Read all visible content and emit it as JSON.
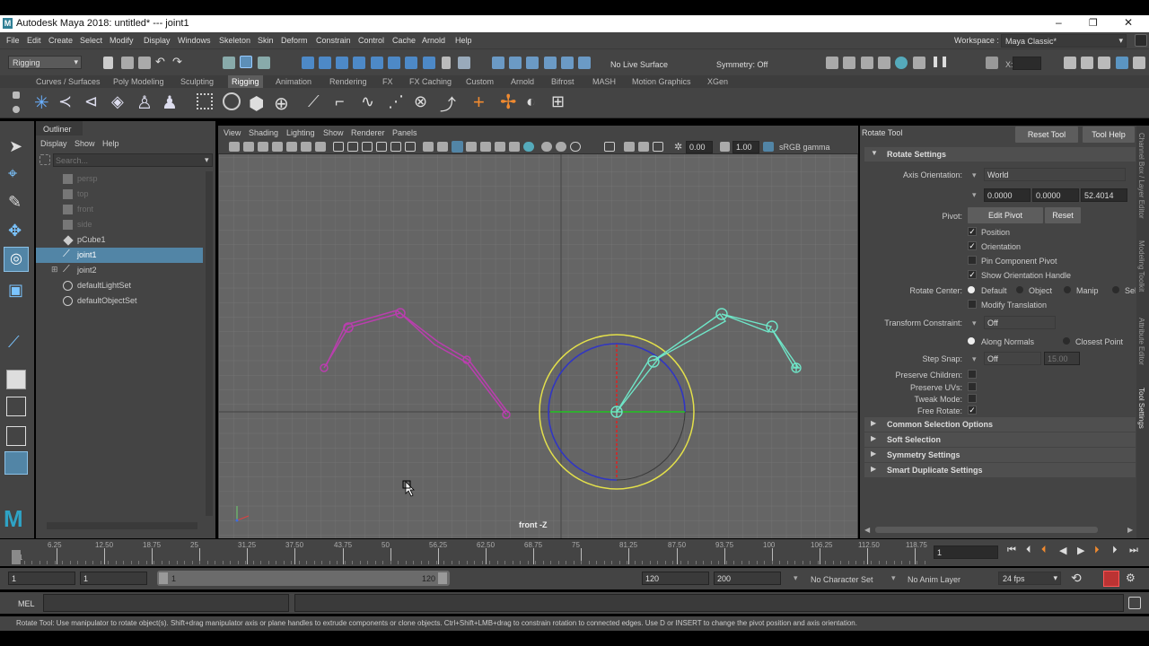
{
  "window": {
    "title": "Autodesk Maya 2018: untitled*   ---   joint1",
    "controls": [
      "–",
      "❐",
      "✕"
    ]
  },
  "menubar": {
    "items": [
      "File",
      "Edit",
      "Create",
      "Select",
      "Modify",
      "Display",
      "Windows",
      "Skeleton",
      "Skin",
      "Deform",
      "Constrain",
      "Control",
      "Cache",
      "Arnold",
      "Help"
    ],
    "workspace_label": "Workspace :",
    "workspace_value": "Maya Classic*"
  },
  "statusline": {
    "menuset": "Rigging",
    "live_surface": "No Live Surface",
    "symmetry": "Symmetry: Off",
    "x_label": "X:"
  },
  "shelf_tabs": {
    "items": [
      "Curves / Surfaces",
      "Poly Modeling",
      "Sculpting",
      "Rigging",
      "Animation",
      "Rendering",
      "FX",
      "FX Caching",
      "Custom",
      "Arnold",
      "Bifrost",
      "MASH",
      "Motion Graphics",
      "XGen"
    ],
    "active": "Rigging"
  },
  "outliner": {
    "title": "Outliner",
    "menu": [
      "Display",
      "Show",
      "Help"
    ],
    "search_placeholder": "Search...",
    "items": [
      {
        "name": "persp",
        "dim": true,
        "icon": "camera-icon"
      },
      {
        "name": "top",
        "dim": true,
        "icon": "camera-icon"
      },
      {
        "name": "front",
        "dim": true,
        "icon": "camera-icon"
      },
      {
        "name": "side",
        "dim": true,
        "icon": "camera-icon"
      },
      {
        "name": "pCube1",
        "dim": false,
        "icon": "mesh-icon"
      },
      {
        "name": "joint1",
        "dim": false,
        "icon": "joint-icon",
        "selected": true
      },
      {
        "name": "joint2",
        "dim": false,
        "icon": "joint-icon",
        "expand": true
      },
      {
        "name": "defaultLightSet",
        "dim": false,
        "icon": "set-icon"
      },
      {
        "name": "defaultObjectSet",
        "dim": false,
        "icon": "set-icon"
      }
    ]
  },
  "viewport": {
    "menu": [
      "View",
      "Shading",
      "Lighting",
      "Show",
      "Renderer",
      "Panels"
    ],
    "exposure": "0.00",
    "gamma": "1.00",
    "colorspace": "sRGB gamma",
    "camera_label": "front -Z"
  },
  "attr": {
    "panel_title": "Rotate Tool",
    "reset_tool": "Reset Tool",
    "tool_help": "Tool Help",
    "section_rotate": "Rotate Settings",
    "axis_orientation_label": "Axis Orientation:",
    "axis_orientation_value": "World",
    "axis_values": [
      "0.0000",
      "0.0000",
      "52.4014"
    ],
    "pivot_label": "Pivot:",
    "edit_pivot": "Edit Pivot",
    "reset": "Reset",
    "position": "Position",
    "orientation": "Orientation",
    "pin_component_pivot": "Pin Component Pivot",
    "show_orientation_handle": "Show Orientation Handle",
    "rotate_center_label": "Rotate Center:",
    "rotate_center_options": [
      "Default",
      "Object",
      "Manip",
      "Sel"
    ],
    "modify_translation": "Modify Translation",
    "transform_constraint_label": "Transform Constraint:",
    "transform_constraint_value": "Off",
    "along_normals": "Along Normals",
    "closest_point": "Closest Point",
    "step_snap_label": "Step Snap:",
    "step_snap_value": "Off",
    "step_snap_amount": "15.00",
    "preserve_children": "Preserve Children:",
    "preserve_uvs": "Preserve UVs:",
    "tweak_mode": "Tweak Mode:",
    "free_rotate": "Free Rotate:",
    "sections": [
      "Common Selection Options",
      "Soft Selection",
      "Symmetry Settings",
      "Smart Duplicate Settings"
    ]
  },
  "side_tabs": [
    "Channel Box / Layer Editor",
    "Modeling Toolkit",
    "Attribute Editor",
    "Tool Settings"
  ],
  "timeline": {
    "ticks": [
      "1",
      "6.25",
      "12.50",
      "18.75",
      "25",
      "31.25",
      "37.50",
      "43.75",
      "50",
      "56.25",
      "62.50",
      "68.75",
      "75",
      "81.25",
      "87.50",
      "93.75",
      "100",
      "106.25",
      "112.50",
      "118.75"
    ],
    "current_frame": "1"
  },
  "range": {
    "start": "1",
    "playback_start": "1",
    "slider_start": "1",
    "slider_end": "120",
    "playback_end": "120",
    "end": "200",
    "character_set": "No Character Set",
    "anim_layer": "No Anim Layer",
    "fps": "24 fps"
  },
  "cmdline": {
    "label": "MEL"
  },
  "help_line": "Rotate Tool: Use manipulator to rotate object(s). Shift+drag manipulator axis or plane handles to extrude components or clone objects. Ctrl+Shift+LMB+drag to constrain rotation to connected edges. Use D or INSERT to change the pivot position and axis orientation.",
  "colors": {
    "selection": "#5285a6",
    "joint_pink": "#b93fae",
    "joint_cyan": "#6fe6c8",
    "manip_yellow": "#e3e04a",
    "viewport_bg": "#656565"
  }
}
